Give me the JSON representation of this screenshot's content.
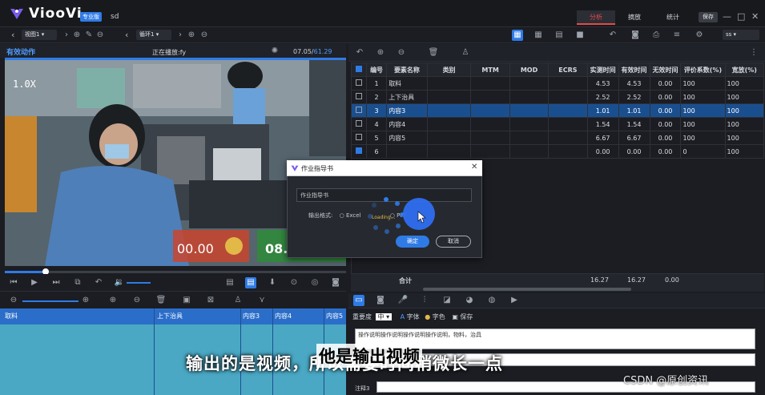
{
  "app": {
    "brand": "ViooVi",
    "edition_badge": "专业版",
    "document_name": "sd"
  },
  "top_tabs": [
    "分析",
    "摘放",
    "统计"
  ],
  "top_save": "保存",
  "toolbar": {
    "view_select": "视图1",
    "loop_select": "循环1",
    "right_select": "ss"
  },
  "video_panel": {
    "title": "有效动作",
    "status": "正在播放:fy",
    "time_current": "07.05/",
    "time_total": "61.29",
    "speed": "1.0X",
    "overlay_value": "00.00",
    "overlay_value2": "08."
  },
  "timeline": {
    "labels": [
      "取料",
      "上下治具",
      "内容3",
      "内容4",
      "内容5"
    ]
  },
  "table": {
    "headers": [
      "编号",
      "要素名称",
      "类别",
      "MTM",
      "MOD",
      "ECRS",
      "实测时间",
      "有效时间",
      "无效时间",
      "评价系数(%)",
      "宽放(%)"
    ],
    "rows": [
      {
        "no": "1",
        "name": "取料",
        "measured": "4.53",
        "effective": "4.53",
        "invalid": "0.00",
        "eval": "100",
        "allow": "100",
        "checked": false,
        "selected": false
      },
      {
        "no": "2",
        "name": "上下治具",
        "measured": "2.52",
        "effective": "2.52",
        "invalid": "0.00",
        "eval": "100",
        "allow": "100",
        "checked": false,
        "selected": false
      },
      {
        "no": "3",
        "name": "内容3",
        "measured": "1.01",
        "effective": "1.01",
        "invalid": "0.00",
        "eval": "100",
        "allow": "100",
        "checked": false,
        "selected": true
      },
      {
        "no": "4",
        "name": "内容4",
        "measured": "1.54",
        "effective": "1.54",
        "invalid": "0.00",
        "eval": "100",
        "allow": "100",
        "checked": false,
        "selected": false
      },
      {
        "no": "5",
        "name": "内容5",
        "measured": "6.67",
        "effective": "6.67",
        "invalid": "0.00",
        "eval": "100",
        "allow": "100",
        "checked": false,
        "selected": false
      },
      {
        "no": "6",
        "name": "",
        "measured": "0.00",
        "effective": "0.00",
        "invalid": "0.00",
        "eval": "0",
        "allow": "100",
        "checked": true,
        "selected": false
      }
    ],
    "totals": {
      "label": "合计",
      "measured": "16.27",
      "effective": "16.27",
      "invalid": "0.00"
    }
  },
  "editor": {
    "importance_label": "重要度",
    "importance_value": "中",
    "font_label": "字体",
    "color_label": "字色",
    "save_label": "保存",
    "text": "操作说明操作说明操作说明操作说明，物料，治具",
    "note_label": "注释3"
  },
  "dialog": {
    "title": "作业指导书",
    "input_value": "作业指导书",
    "format_label": "输出格式:",
    "option_excel": "Excel",
    "option_ppt": "PPT",
    "loading": "Loading...",
    "ok": "确定",
    "cancel": "取消"
  },
  "subtitle": {
    "line": "输出的是视频，所以需要时间稍微长一点",
    "overlay": "他是输出视频"
  },
  "watermark": "CSDN @原创资讯"
}
